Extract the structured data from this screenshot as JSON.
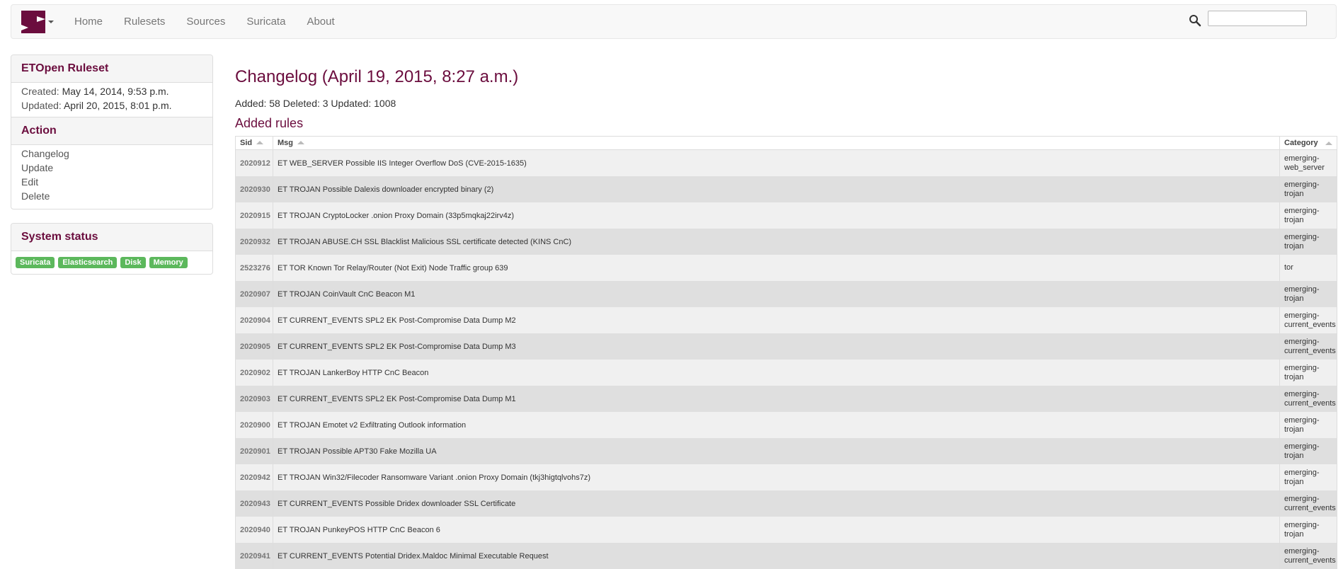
{
  "nav": {
    "items": [
      "Home",
      "Rulesets",
      "Sources",
      "Suricata",
      "About"
    ],
    "search_placeholder": ""
  },
  "sidebar": {
    "ruleset_title": "ETOpen Ruleset",
    "created_label": "Created:",
    "created_value": "May 14, 2014, 9:53 p.m.",
    "updated_label": "Updated:",
    "updated_value": "April 20, 2015, 8:01 p.m.",
    "action_title": "Action",
    "actions": [
      "Changelog",
      "Update",
      "Edit",
      "Delete"
    ],
    "status_title": "System status",
    "status_badges": [
      "Suricata",
      "Elasticsearch",
      "Disk",
      "Memory"
    ]
  },
  "main": {
    "title": "Changelog (April 19, 2015, 8:27 a.m.)",
    "summary": "Added: 58 Deleted: 3 Updated: 1008",
    "section_title": "Added rules",
    "columns": [
      "Sid",
      "Msg",
      "Category"
    ],
    "rows": [
      {
        "sid": "2020912",
        "msg": "ET WEB_SERVER Possible IIS Integer Overflow DoS (CVE-2015-1635)",
        "category": "emerging-web_server"
      },
      {
        "sid": "2020930",
        "msg": "ET TROJAN Possible Dalexis downloader encrypted binary (2)",
        "category": "emerging-trojan"
      },
      {
        "sid": "2020915",
        "msg": "ET TROJAN CryptoLocker .onion Proxy Domain (33p5mqkaj22irv4z)",
        "category": "emerging-trojan"
      },
      {
        "sid": "2020932",
        "msg": "ET TROJAN ABUSE.CH SSL Blacklist Malicious SSL certificate detected (KINS CnC)",
        "category": "emerging-trojan"
      },
      {
        "sid": "2523276",
        "msg": "ET TOR Known Tor Relay/Router (Not Exit) Node Traffic group 639",
        "category": "tor"
      },
      {
        "sid": "2020907",
        "msg": "ET TROJAN CoinVault CnC Beacon M1",
        "category": "emerging-trojan"
      },
      {
        "sid": "2020904",
        "msg": "ET CURRENT_EVENTS SPL2 EK Post-Compromise Data Dump M2",
        "category": "emerging-current_events"
      },
      {
        "sid": "2020905",
        "msg": "ET CURRENT_EVENTS SPL2 EK Post-Compromise Data Dump M3",
        "category": "emerging-current_events"
      },
      {
        "sid": "2020902",
        "msg": "ET TROJAN LankerBoy HTTP CnC Beacon",
        "category": "emerging-trojan"
      },
      {
        "sid": "2020903",
        "msg": "ET CURRENT_EVENTS SPL2 EK Post-Compromise Data Dump M1",
        "category": "emerging-current_events"
      },
      {
        "sid": "2020900",
        "msg": "ET TROJAN Emotet v2 Exfiltrating Outlook information",
        "category": "emerging-trojan"
      },
      {
        "sid": "2020901",
        "msg": "ET TROJAN Possible APT30 Fake Mozilla UA",
        "category": "emerging-trojan"
      },
      {
        "sid": "2020942",
        "msg": "ET TROJAN Win32/Filecoder Ransomware Variant .onion Proxy Domain (tkj3higtqlvohs7z)",
        "category": "emerging-trojan"
      },
      {
        "sid": "2020943",
        "msg": "ET CURRENT_EVENTS Possible Dridex downloader SSL Certificate",
        "category": "emerging-current_events"
      },
      {
        "sid": "2020940",
        "msg": "ET TROJAN PunkeyPOS HTTP CnC Beacon 6",
        "category": "emerging-trojan"
      },
      {
        "sid": "2020941",
        "msg": "ET CURRENT_EVENTS Potential Dridex.Maldoc Minimal Executable Request",
        "category": "emerging-current_events"
      }
    ]
  },
  "colors": {
    "brand": "#6b0d3e",
    "badge_green": "#5cb85c",
    "row_odd": "#f0f0f0",
    "row_even": "#dfdfdf"
  },
  "icons": {
    "logo": "scirius-logo",
    "search": "search-icon",
    "sort": "sort-arrow-icon"
  }
}
